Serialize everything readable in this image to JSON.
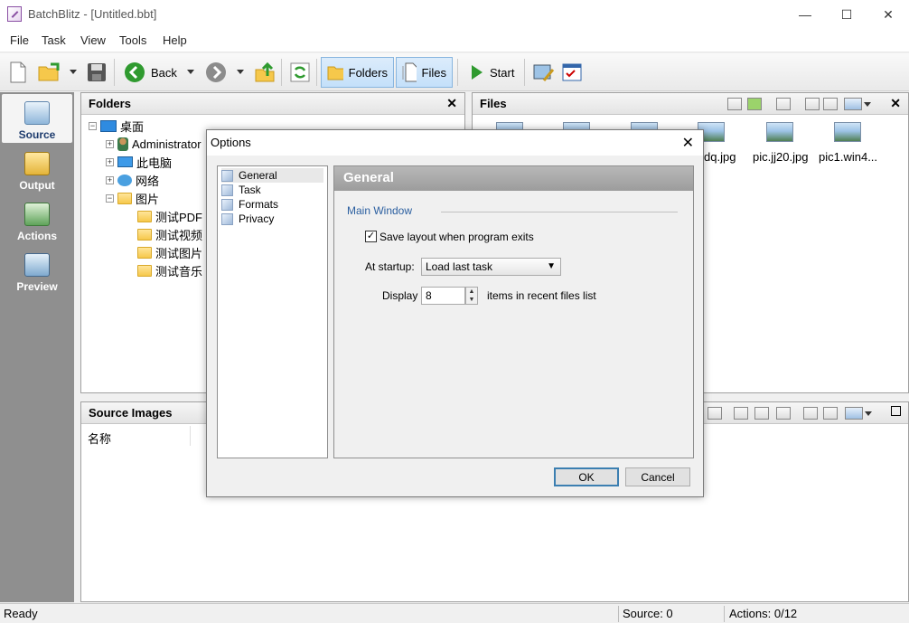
{
  "window": {
    "title": "BatchBlitz - [Untitled.bbt]",
    "minimize": "—",
    "maximize": "☐",
    "close": "✕"
  },
  "menu": [
    "File",
    "Task",
    "View",
    "Tools",
    "Help"
  ],
  "toolbar": {
    "back_label": "Back",
    "folders_label": "Folders",
    "files_label": "Files",
    "start_label": "Start"
  },
  "leftnav": {
    "items": [
      {
        "label": "Source",
        "icon": "source-icon"
      },
      {
        "label": "Output",
        "icon": "output-icon"
      },
      {
        "label": "Actions",
        "icon": "actions-icon"
      },
      {
        "label": "Preview",
        "icon": "preview-icon"
      }
    ]
  },
  "folders_panel": {
    "title": "Folders",
    "tree": [
      {
        "label": "桌面",
        "icon": "desktop-icon"
      },
      {
        "label": "Administrator",
        "icon": "user-icon"
      },
      {
        "label": "此电脑",
        "icon": "computer-icon"
      },
      {
        "label": "网络",
        "icon": "network-icon"
      },
      {
        "label": "图片",
        "icon": "folder-icon"
      },
      {
        "label": "测试PDF",
        "icon": "folder-icon"
      },
      {
        "label": "测试视频",
        "icon": "folder-icon"
      },
      {
        "label": "测试图片",
        "icon": "folder-icon"
      },
      {
        "label": "测试音乐",
        "icon": "folder-icon"
      }
    ]
  },
  "files_panel": {
    "title": "Files",
    "files": [
      "dq.jpg",
      "pic.jj20.jpg",
      "pic1.win4..."
    ]
  },
  "source_images_panel": {
    "title": "Source Images",
    "column_header": "名称"
  },
  "statusbar": {
    "state": "Ready",
    "source": "Source: 0",
    "actions": "Actions: 0/12"
  },
  "dialog": {
    "title": "Options",
    "close": "✕",
    "categories": [
      "General",
      "Task",
      "Formats",
      "Privacy"
    ],
    "selected_category": "General",
    "content_title": "General",
    "section_title": "Main Window",
    "save_layout_label": "Save layout when program exits",
    "save_layout_checked": true,
    "check_mark": "✓",
    "startup_label": "At startup:",
    "startup_value": "Load last task",
    "display_label": "Display",
    "recent_files_value": "8",
    "recent_files_suffix": "items in recent files list",
    "ok_label": "OK",
    "cancel_label": "Cancel"
  }
}
